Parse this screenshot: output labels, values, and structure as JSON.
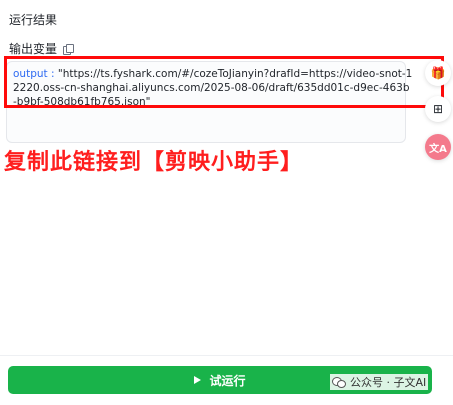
{
  "panel": {
    "section_title": "运行结果",
    "variable_label": "输出变量"
  },
  "output": {
    "key": "output : ",
    "value": "\"https://ts.fyshark.com/#/cozeToJianyin?drafId=https://video-snot-12220.oss-cn-shanghai.aliyuncs.com/2025-08-06/draft/635dd01c-d9ec-463b-b9bf-508db61fb765.json\""
  },
  "annotation": {
    "note": "复制此链接到【剪映小助手】",
    "highlight_color": "#ff0a0a"
  },
  "side_rail": {
    "items": [
      {
        "icon": "gift-icon",
        "glyph": "🎁"
      },
      {
        "icon": "grid-icon",
        "glyph": "⊞"
      },
      {
        "icon": "translate-icon",
        "glyph": "文A"
      }
    ]
  },
  "footer": {
    "run_label": "试运行",
    "accent_color": "#19b34a"
  },
  "watermark": {
    "text": "公众号 · 子文AI"
  }
}
